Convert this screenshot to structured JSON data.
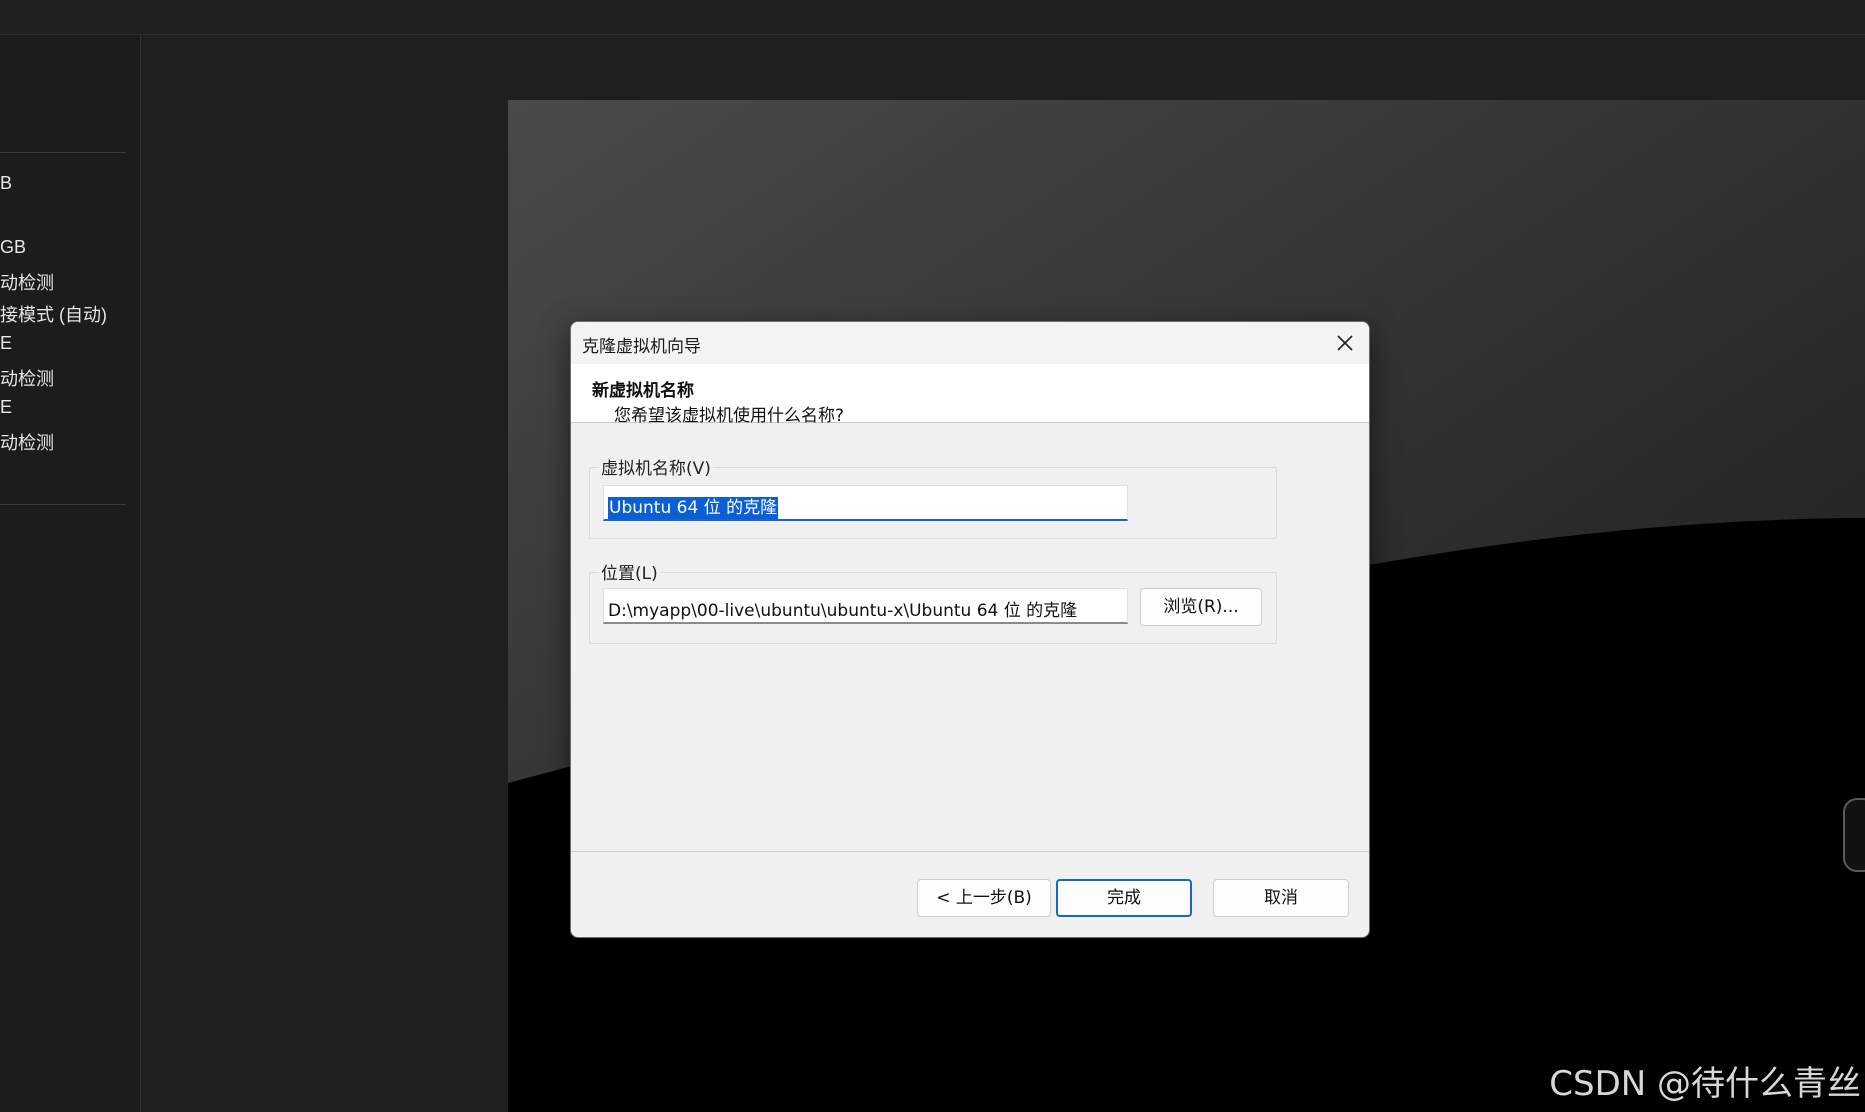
{
  "sidebar": {
    "items": [
      {
        "label": "B"
      },
      {
        "label": "GB"
      },
      {
        "label": "动检测"
      },
      {
        "label": "接模式 (自动)"
      },
      {
        "label": "E"
      },
      {
        "label": "动检测"
      },
      {
        "label": "E"
      },
      {
        "label": "动检测"
      }
    ]
  },
  "dialog": {
    "title": "克隆虚拟机向导",
    "header_title": "新虚拟机名称",
    "header_subtitle": "您希望该虚拟机使用什么名称?",
    "name_group_label": "虚拟机名称(V)",
    "name_value": "Ubuntu 64 位 的克隆",
    "location_group_label": "位置(L)",
    "location_value": "D:\\myapp\\00-live\\ubuntu\\ubuntu-x\\Ubuntu 64 位 的克隆",
    "browse_label": "浏览(R)...",
    "back_label": "< 上一步(B)",
    "finish_label": "完成",
    "cancel_label": "取消"
  },
  "watermark": "CSDN @待什么青丝",
  "colors": {
    "accent": "#1a64c8",
    "selection": "#0a5fd6",
    "dialog_bg": "#f0f0f0",
    "app_bg": "#1f1f1f"
  },
  "icons": {
    "close": "close-icon"
  }
}
